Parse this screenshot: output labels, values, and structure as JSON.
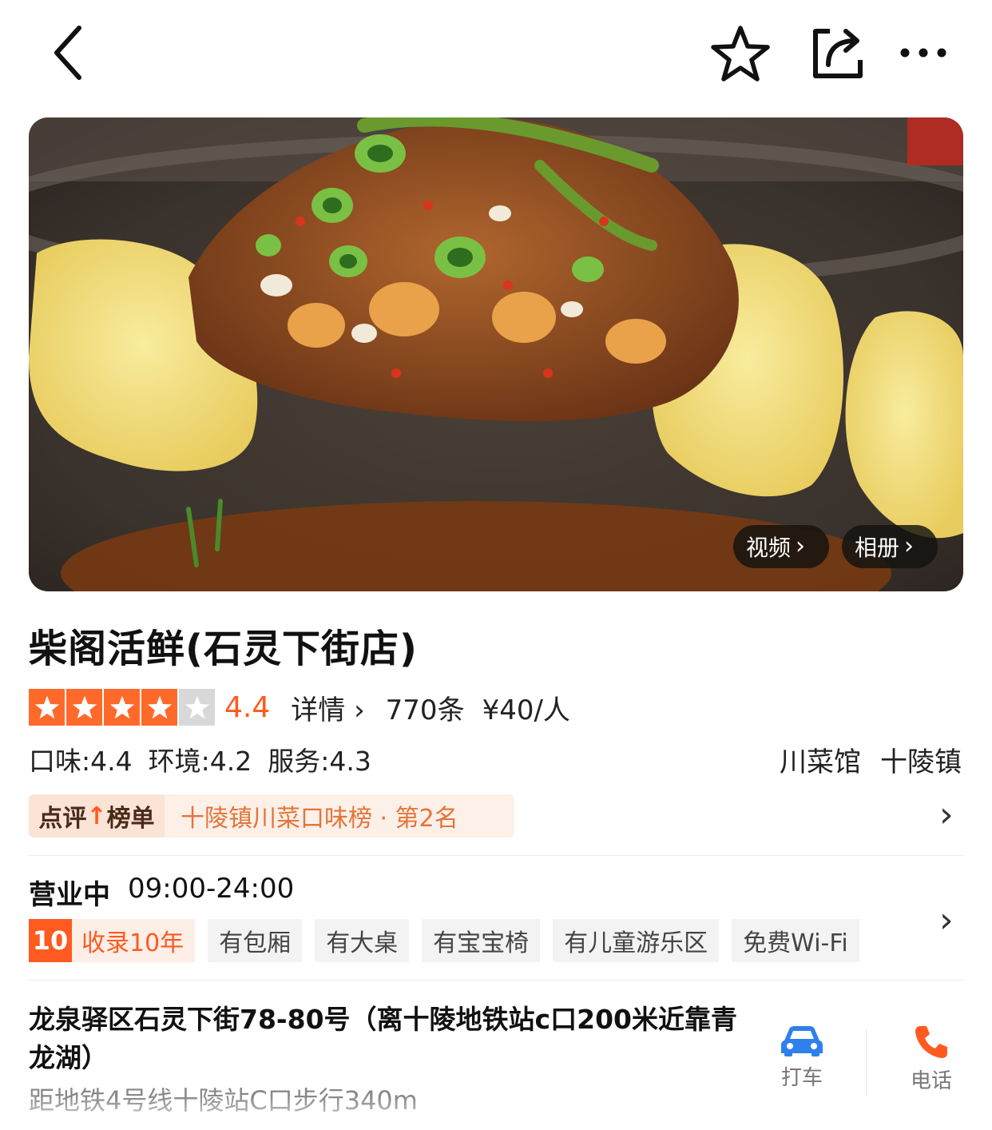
{
  "nav": {
    "back_icon": "chevron-left-icon",
    "favorite_icon": "star-outline-icon",
    "share_icon": "share-icon",
    "more_icon": "more-dots-icon"
  },
  "hero": {
    "video_label": "视频",
    "album_label": "相册"
  },
  "shop": {
    "name": "柴阁活鲜(石灵下街店)",
    "rating": 4.4,
    "rating_text": "4.4",
    "stars_filled": 4,
    "detail_label": "详情",
    "review_count": "770条",
    "price": "¥40/人",
    "taste": "口味:4.4",
    "environment": "环境:4.2",
    "service": "服务:4.3",
    "category": "川菜馆",
    "area": "十陵镇"
  },
  "ranking": {
    "tag_prefix": "点评",
    "tag_suffix": "榜单",
    "text": "十陵镇川菜口味榜 · 第2名"
  },
  "hours": {
    "status": "营业中",
    "time": "09:00-24:00"
  },
  "tags": {
    "years_num": "10",
    "years_text": "收录10年",
    "items": [
      "有包厢",
      "有大桌",
      "有宝宝椅",
      "有儿童游乐区",
      "免费Wi-Fi"
    ]
  },
  "location": {
    "address": "龙泉驿区石灵下街78-80号（离十陵地铁站c口200米近靠青龙湖）",
    "metro": "距地铁4号线十陵站C口步行340m",
    "taxi_label": "打车",
    "phone_label": "电话"
  },
  "colors": {
    "accent": "#ff5a1f",
    "star_on": "#ff6a2b",
    "star_off": "#d8d8d8",
    "taxi_blue": "#2f80ed"
  }
}
